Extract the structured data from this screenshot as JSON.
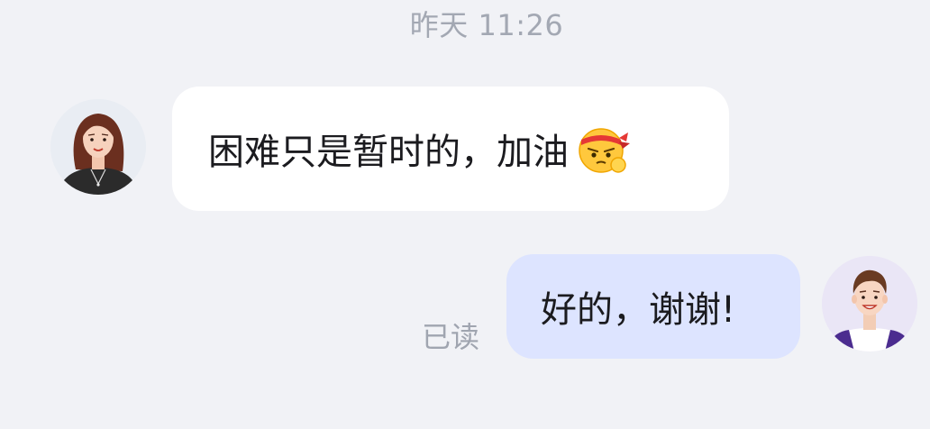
{
  "header": {
    "timestamp": "昨天 11:26"
  },
  "messages": [
    {
      "side": "left",
      "text": "困难只是暂时的，加油",
      "emoji": "headband-fighting-emoji",
      "avatar": "woman-avatar"
    },
    {
      "side": "right",
      "text": "好的，谢谢!",
      "status": "已读",
      "avatar": "man-avatar"
    }
  ],
  "colors": {
    "background": "#f1f2f6",
    "incoming_bubble": "#ffffff",
    "outgoing_bubble": "#dde4ff",
    "meta_text": "#a3a8b3"
  }
}
